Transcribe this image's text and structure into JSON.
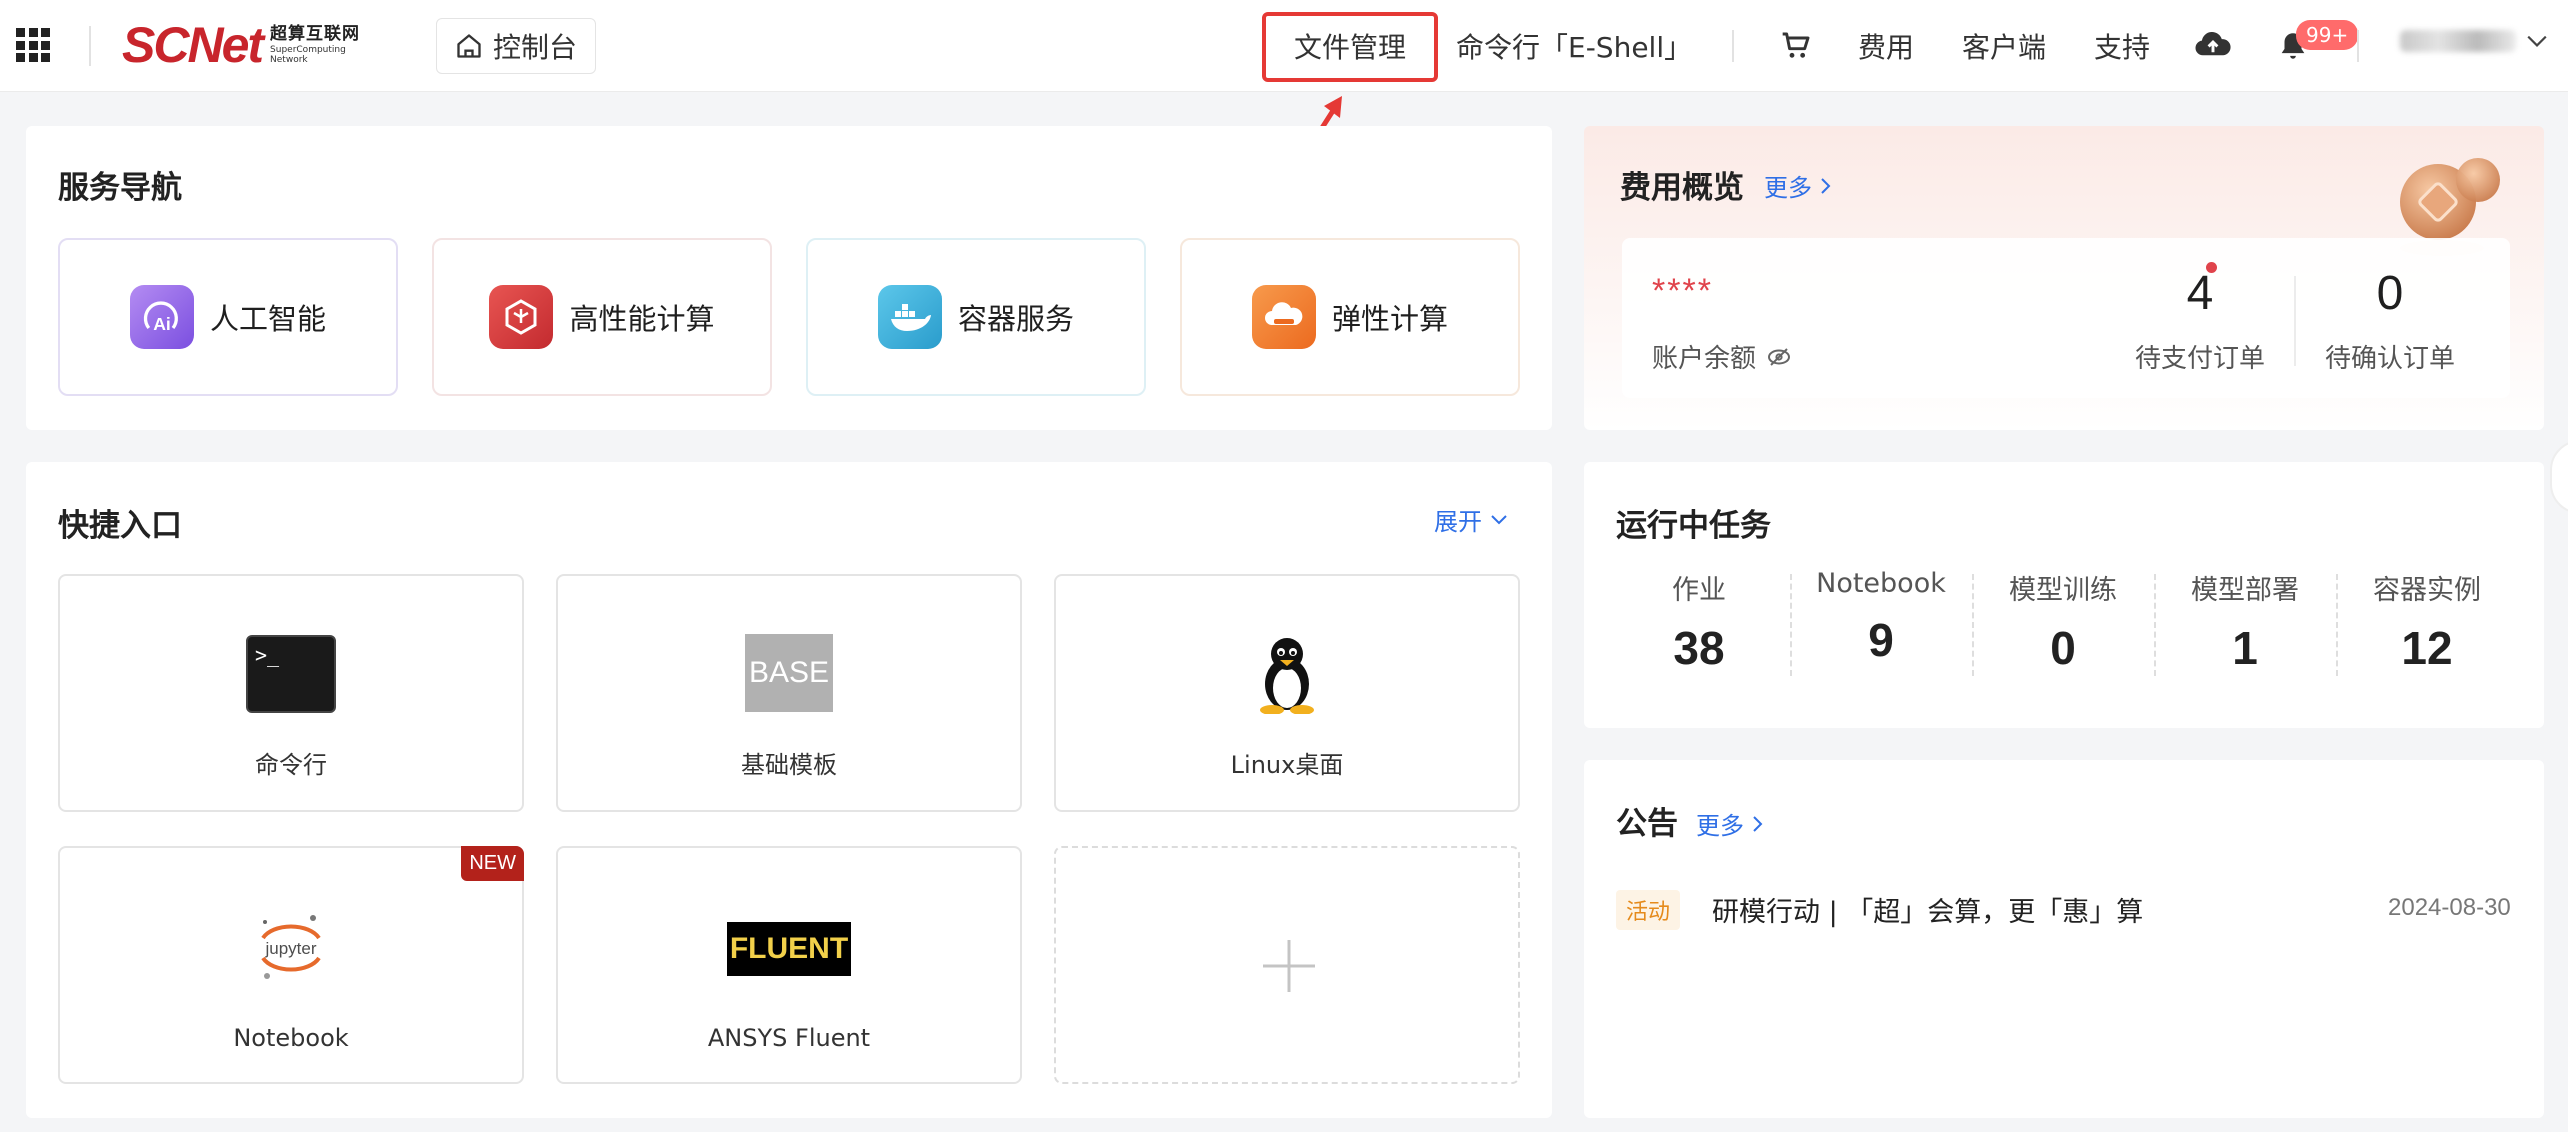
{
  "header": {
    "logo_main": "SCNet",
    "logo_cn": "超算互联网",
    "logo_en_1": "SuperComputing",
    "logo_en_2": "Network",
    "console_label": "控制台",
    "nav": {
      "file_management": "文件管理",
      "eshell": "命令行「E-Shell」",
      "fees": "费用",
      "client": "客户端",
      "support": "支持"
    },
    "notification_badge": "99+"
  },
  "service_nav": {
    "title": "服务导航",
    "items": [
      {
        "label": "人工智能",
        "icon": "ai-icon",
        "color": "#8b5cf6"
      },
      {
        "label": "高性能计算",
        "icon": "hpc-icon",
        "color": "#d9363e"
      },
      {
        "label": "容器服务",
        "icon": "container-icon",
        "color": "#2fa9d6"
      },
      {
        "label": "弹性计算",
        "icon": "cloud-compute-icon",
        "color": "#f07b2b"
      }
    ]
  },
  "quick_entry": {
    "title": "快捷入口",
    "expand_label": "展开",
    "items": [
      {
        "label": "命令行",
        "icon": "terminal-icon"
      },
      {
        "label": "基础模板",
        "icon": "base-icon",
        "icon_text": "BASE"
      },
      {
        "label": "Linux桌面",
        "icon": "linux-penguin-icon"
      },
      {
        "label": "Notebook",
        "icon": "jupyter-icon",
        "icon_text": "jupyter",
        "tag": "NEW"
      },
      {
        "label": "ANSYS Fluent",
        "icon": "fluent-icon",
        "icon_text": "FLUENT"
      }
    ]
  },
  "fee_overview": {
    "title": "费用概览",
    "more_label": "更多",
    "balance_masked": "****",
    "balance_label": "账户余额",
    "pending_payment_value": "4",
    "pending_payment_label": "待支付订单",
    "pending_confirm_value": "0",
    "pending_confirm_label": "待确认订单"
  },
  "running_tasks": {
    "title": "运行中任务",
    "columns": [
      {
        "label": "作业",
        "value": "38"
      },
      {
        "label": "Notebook",
        "value": "9"
      },
      {
        "label": "模型训练",
        "value": "0"
      },
      {
        "label": "模型部署",
        "value": "1"
      },
      {
        "label": "容器实例",
        "value": "12"
      }
    ]
  },
  "announcements": {
    "title": "公告",
    "more_label": "更多",
    "items": [
      {
        "tag": "活动",
        "text": "研模行动 | 「超」会算，更「惠」算",
        "date": "2024-08-30"
      }
    ]
  },
  "colors": {
    "brand_red": "#c8252c",
    "link_blue": "#2f6fe6",
    "highlight_red": "#e53935"
  }
}
